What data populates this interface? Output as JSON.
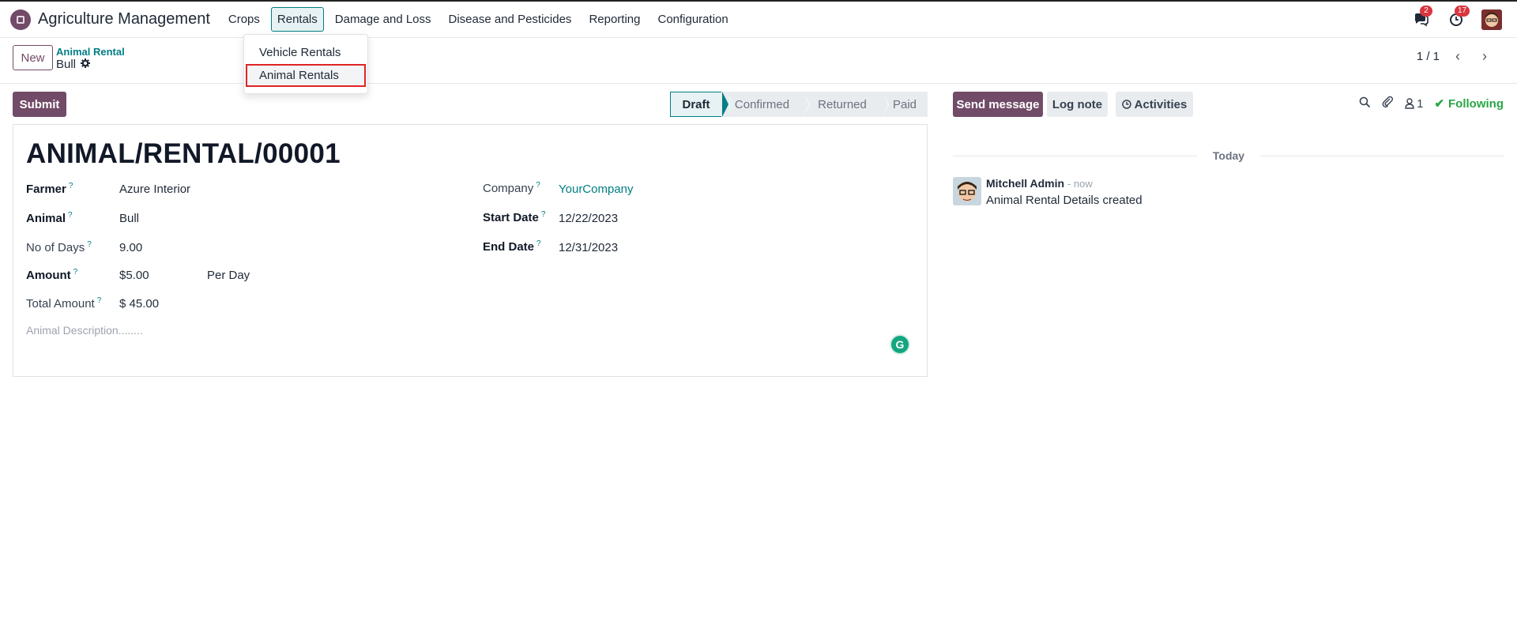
{
  "app": {
    "title": "Agriculture Management"
  },
  "menu": [
    "Crops",
    "Rentals",
    "Damage and Loss",
    "Disease and Pesticides",
    "Reporting",
    "Configuration"
  ],
  "dropdown": [
    "Vehicle Rentals",
    "Animal Rentals"
  ],
  "nav": {
    "messages_count": "2",
    "activities_count": "17"
  },
  "control_panel": {
    "new_label": "New",
    "breadcrumb_parent": "Animal Rental",
    "breadcrumb_current": "Bull",
    "pager": "1 / 1"
  },
  "statusbar": {
    "submit_label": "Submit",
    "stages": [
      "Draft",
      "Confirmed",
      "Returned",
      "Paid"
    ],
    "current_stage": "Draft"
  },
  "form": {
    "title": "ANIMAL/RENTAL/00001",
    "help_mark": "?",
    "farmer_label": "Farmer",
    "farmer": "Azure Interior",
    "animal_label": "Animal",
    "animal": "Bull",
    "days_label": "No of Days",
    "days": "9.00",
    "amount_label": "Amount",
    "amount": "$5.00",
    "amount_unit": "Per Day",
    "total_label": "Total Amount",
    "total": "$ 45.00",
    "company_label": "Company",
    "company": "YourCompany",
    "start_label": "Start Date",
    "start": "12/22/2023",
    "end_label": "End Date",
    "end": "12/31/2023",
    "description_placeholder": "Animal Description........"
  },
  "chatter": {
    "send_message": "Send message",
    "log_note": "Log note",
    "activities": "Activities",
    "followers_count": "1",
    "following": "Following",
    "today": "Today",
    "author": "Mitchell Admin",
    "time": "- now",
    "body": "Animal Rental Details created"
  },
  "colors": {
    "brand": "#714B67",
    "accent": "#017e84",
    "success": "#28a745",
    "badge": "#d9363e"
  }
}
